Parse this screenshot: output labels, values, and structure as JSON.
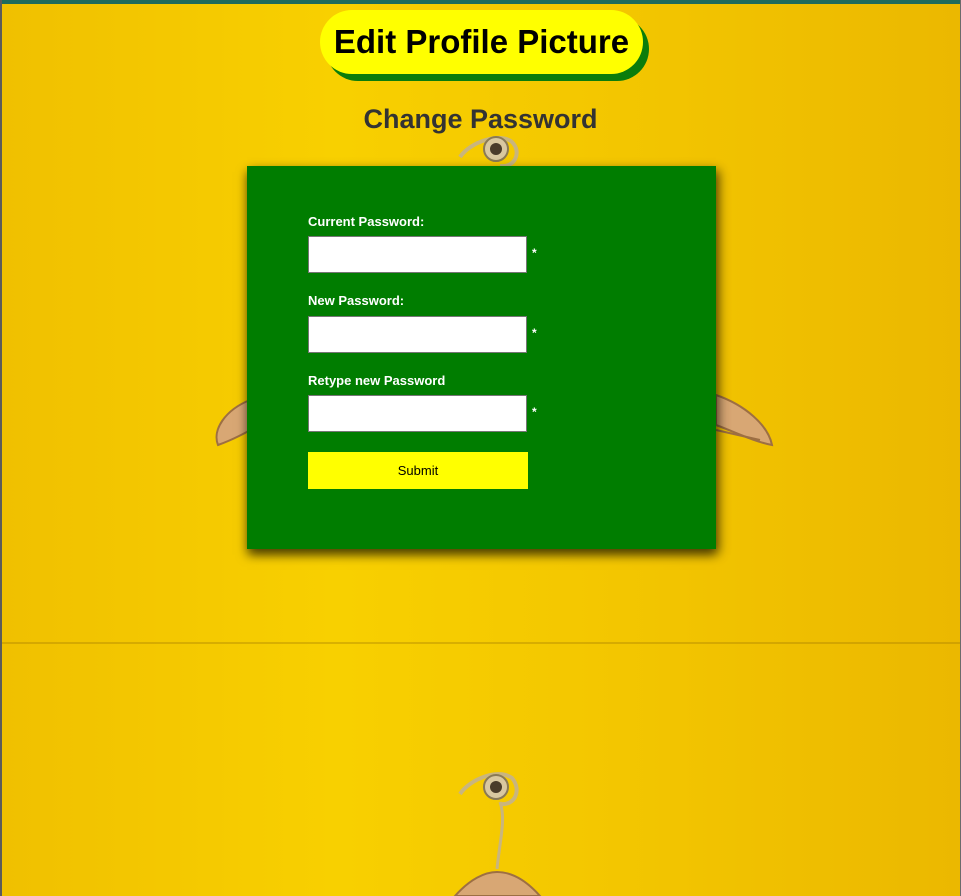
{
  "header": {
    "edit_profile_picture_label": "Edit Profile Picture",
    "page_heading": "Change Password"
  },
  "form": {
    "fields": [
      {
        "label": "Current Password:",
        "value": "",
        "required_mark": "*"
      },
      {
        "label": "New Password:",
        "value": "",
        "required_mark": "*"
      },
      {
        "label": "Retype new Password",
        "value": "",
        "required_mark": "*"
      }
    ],
    "submit_label": "Submit"
  },
  "colors": {
    "accent_button": "#ffff00",
    "panel_background": "#007d00",
    "page_background": "#f2c200",
    "heading_text": "#333333"
  },
  "icons": {
    "background_decoration": "clothes-hanger-icon"
  }
}
